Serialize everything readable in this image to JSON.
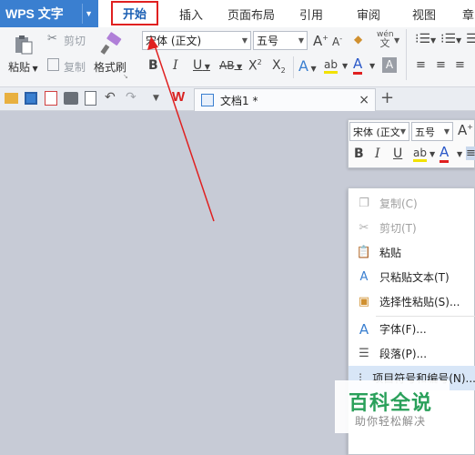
{
  "colors": {
    "accent": "#3a7fd0",
    "highlight_box": "#e02020",
    "arrow": "#e02020",
    "watermark_green": "#2aa05a"
  },
  "title_bar": {
    "app_menu": "WPS 文字",
    "tabs": [
      "开始",
      "插入",
      "页面布局",
      "引用",
      "审阅",
      "视图",
      "章"
    ]
  },
  "ribbon": {
    "paste": "粘贴",
    "cut": "剪切",
    "copy": "复制",
    "format_painter": "格式刷",
    "font_name": "宋体 (正文)",
    "font_size": "五号",
    "grow_font": "A",
    "shrink_font": "A",
    "bold": "B",
    "italic": "I",
    "underline": "U",
    "strike": "AB",
    "superscript": "X",
    "subscript": "X",
    "text_effect": "A",
    "highlight": "ab",
    "font_color": "A",
    "char_shade": "A",
    "phonetic": "wén"
  },
  "quick_bar": {
    "document_tab": "文档1 *",
    "close": "×",
    "new_tab": "+"
  },
  "mini_toolbar": {
    "font_name": "宋体 (正文",
    "font_size": "五号",
    "grow_font": "A",
    "bold": "B",
    "italic": "I",
    "underline": "U",
    "highlight": "ab",
    "font_color": "A"
  },
  "context_menu": {
    "items": [
      {
        "label": "复制(C)",
        "icon": "copy-icon",
        "disabled": true
      },
      {
        "label": "剪切(T)",
        "icon": "scissors-icon",
        "disabled": true
      },
      {
        "label": "粘贴",
        "icon": "paste-icon",
        "disabled": false
      },
      {
        "label": "只粘贴文本(T)",
        "icon": "paste-text-icon",
        "disabled": false
      },
      {
        "label": "选择性粘贴(S)...",
        "icon": "paste-special-icon",
        "disabled": false
      },
      {
        "label": "字体(F)...",
        "icon": "font-icon",
        "disabled": false
      },
      {
        "label": "段落(P)...",
        "icon": "paragraph-icon",
        "disabled": false
      },
      {
        "label": "项目符号和编号(N)...",
        "icon": "bullets-icon",
        "disabled": false,
        "highlighted": true
      }
    ]
  },
  "watermark": {
    "title": "百科全说",
    "subtitle": "助你轻松解决"
  }
}
